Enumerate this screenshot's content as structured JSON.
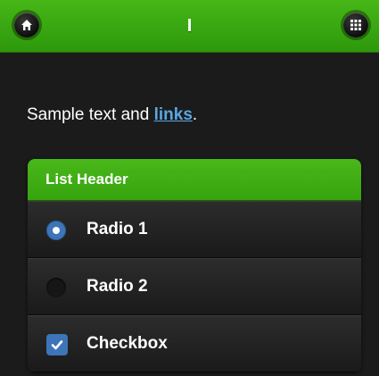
{
  "header": {
    "title": "I",
    "home_icon": "home-icon",
    "grid_icon": "grid-icon",
    "color": "#3aa812"
  },
  "content": {
    "text_before": "Sample text and ",
    "link_text": "links",
    "text_after": "."
  },
  "list": {
    "header": "List Header",
    "items": [
      {
        "type": "radio",
        "label": "Radio 1",
        "checked": true
      },
      {
        "type": "radio",
        "label": "Radio 2",
        "checked": false
      },
      {
        "type": "checkbox",
        "label": "Checkbox",
        "checked": true
      }
    ],
    "accent_color": "#3d75b8"
  }
}
